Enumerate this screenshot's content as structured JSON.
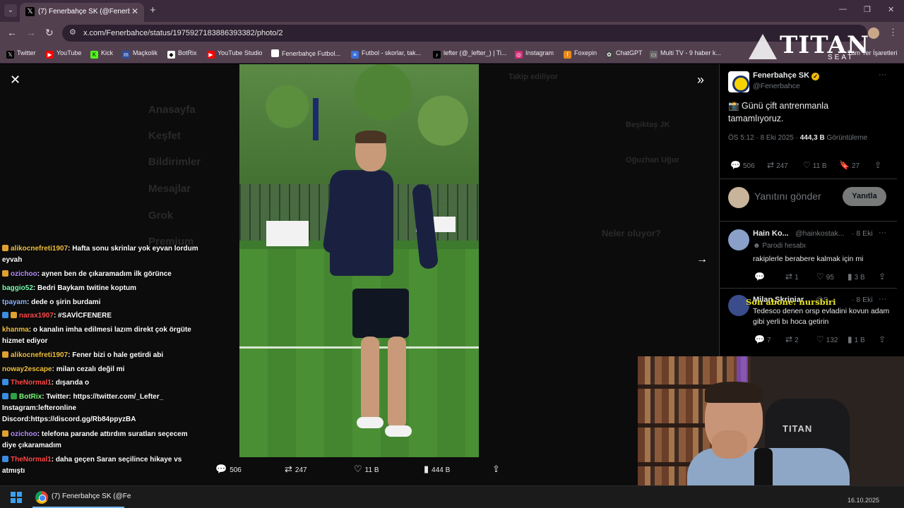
{
  "browser": {
    "tab_title": "(7) Fenerbahçe SK (@Fenerbahçe",
    "url": "x.com/Fenerbahce/status/1975927183886393382/photo/2",
    "bookmarks": [
      "Twitter",
      "YouTube",
      "Kick",
      "Maçkolik",
      "BotRix",
      "YouTube Studio",
      "Fenerbahçe Futbol...",
      "Futbol - skorlar, tak...",
      "lefter (@_lefter_) | Ti...",
      "Instagram",
      "Foxepin",
      "ChatGPT",
      "Multi TV - 9 haber k..."
    ],
    "all_bookmarks": "Tüm Yer İşaretleri"
  },
  "overlay_brand": {
    "word": "TITAN",
    "sub": "SEAT",
    "chair_text": "TITAN"
  },
  "background_nav": [
    "Anasayfa",
    "Keşfet",
    "Bildirimler",
    "Mesajlar",
    "Grok",
    "Premium"
  ],
  "background_right": [
    "Takip ediliyor",
    "Beşiktaş JK",
    "Oğuzhan Uğur",
    "Neler oluyor?"
  ],
  "photo_actions": {
    "replies": "506",
    "retweets": "247",
    "likes": "11 B",
    "views": "444 B"
  },
  "tweet": {
    "name": "Fenerbahçe SK",
    "handle": "@Fenerbahce",
    "text": "📸 Günü çift antrenmanla tamamlıyoruz.",
    "time": "ÖS 5:12 · 8 Eki 2025 · ",
    "views": "444,3 B",
    "views_label": " Görüntüleme",
    "replies": "506",
    "retweets": "247",
    "likes": "11 B",
    "bookmarks": "27"
  },
  "reply_box": {
    "placeholder": "Yanıtını gönder",
    "button": "Yanıtla"
  },
  "replies": [
    {
      "name": "Hain Ko...",
      "handle": "@hainkostak...",
      "time": "· 8 Eki",
      "badge": "Parodi hesabı",
      "text": "rakiplerle berabere kalmak için mi",
      "comments": "",
      "retweets": "1",
      "likes": "95",
      "views": "3 B"
    },
    {
      "name": "Milan Şkriniar",
      "handle": "@S...",
      "time": "· 8 Eki",
      "text": "Tedesco denen orsp evladini kovun adam gibi yerli bı hoca getirin",
      "comments": "7",
      "retweets": "2",
      "likes": "132",
      "views": "1 B"
    }
  ],
  "stream_overlay": {
    "subscriber_text": "Son abone: nursbiri"
  },
  "chat": [
    {
      "user": "alikocnefreti1907",
      "color": "#f0c040",
      "text": ": Hafta sonu skrinlar yok eyvan lordum eyvah"
    },
    {
      "user": "ozichoo",
      "color": "#b68cff",
      "text": ": aynen ben de çıkaramadım ilk görünce"
    },
    {
      "user": "baggio52",
      "color": "#7dffb0",
      "text": ": Bedri Baykam twitine koptum"
    },
    {
      "user": "tpayam",
      "color": "#8ab4ff",
      "text": ": dede o şirin burdami"
    },
    {
      "user": "narax1907",
      "color": "#ff4a4a",
      "text": ": #SAVİCFENERE"
    },
    {
      "user": "khanma",
      "color": "#f0c040",
      "text": ": o kanalın imha edilmesi lazım direkt çok örgüte hizmet ediyor"
    },
    {
      "user": "alikocnefreti1907",
      "color": "#f0c040",
      "text": ": Fener bizi o hale getirdi abi"
    },
    {
      "user": "noway2escape",
      "color": "#f0c040",
      "text": ": milan cezalı değil mi"
    },
    {
      "user": "TheNormal1",
      "color": "#ff4a4a",
      "text": ": dışarıda o"
    },
    {
      "user": "BotRix",
      "color": "#7dff7d",
      "text": ": Twitter: https://twitter.com/_Lefter_ Instagram:lefteronline Discord:https://discord.gg/Rb84ppyzBA"
    },
    {
      "user": "ozichoo",
      "color": "#b68cff",
      "text": ": telefona parande attırdım suratları seçecem diye çıkaramadım"
    },
    {
      "user": "TheNormal1",
      "color": "#ff4a4a",
      "text": ": daha geçen Saran seçilince hikaye vs atmıştı"
    }
  ],
  "taskbar": {
    "window_title": "(7) Fenerbahçe SK (@Fe",
    "date": "16.10.2025"
  }
}
